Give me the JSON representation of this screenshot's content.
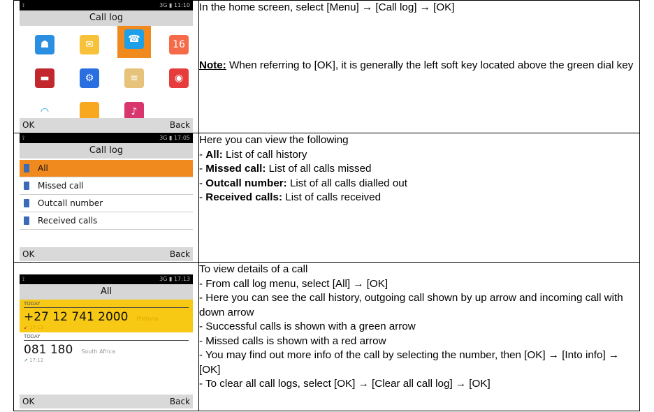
{
  "rows": [
    {
      "screen": {
        "status_time": "11:10",
        "status_net": "3G",
        "title": "Call log",
        "apps": [
          {
            "icon": "contacts-icon",
            "color": "#2a8fe0",
            "glyph": "☗"
          },
          {
            "icon": "message-icon",
            "color": "#f7c23a",
            "glyph": "✉"
          },
          {
            "icon": "call-log-icon",
            "color": "#1ea0e8",
            "glyph": "☎"
          },
          {
            "icon": "calendar-icon",
            "color": "#f56b4a",
            "glyph": "16"
          },
          {
            "icon": "toolbox-icon",
            "color": "#c1272d",
            "glyph": "▬"
          },
          {
            "icon": "settings-icon",
            "color": "#2a6fe0",
            "glyph": "⚙"
          },
          {
            "icon": "folder-icon",
            "color": "#e7c27a",
            "glyph": "≡"
          },
          {
            "icon": "browser-icon",
            "color": "#e63c3c",
            "glyph": "◉"
          },
          {
            "icon": "wifi-icon",
            "color": "#ffffff",
            "glyph": "◠"
          },
          {
            "icon": "notes-icon",
            "color": "#f7a81e",
            "glyph": ""
          },
          {
            "icon": "music-icon",
            "color": "#d9366e",
            "glyph": "♪"
          }
        ],
        "ok": "OK",
        "back": "Back"
      },
      "text": {
        "line1": "In the home screen, select [Menu] → [Call log] → [OK]",
        "note_label": "Note:",
        "note_body": " When referring to [OK], it is generally the left soft key located above the green dial key"
      }
    },
    {
      "screen": {
        "status_time": "17:05",
        "status_net": "3G",
        "title": "Call log",
        "items": [
          "All",
          "Missed call",
          "Outcall number",
          "Received calls"
        ],
        "ok": "OK",
        "back": "Back"
      },
      "text": {
        "intro": "Here you can view the following",
        "items": [
          {
            "label": "All:",
            "desc": " List of call history"
          },
          {
            "label": "Missed call:",
            "desc": " List of all calls missed"
          },
          {
            "label": "Outcall number:",
            "desc": " List of all calls dialled out"
          },
          {
            "label": "Received calls:",
            "desc": " List of calls received"
          }
        ]
      }
    },
    {
      "screen": {
        "status_time": "17:13",
        "status_net": "3G",
        "title": "All",
        "entries": [
          {
            "day": "TODAY",
            "number": "+27 12 741 2000",
            "place": "Pretoria",
            "time": "17:13",
            "arrow": "↙",
            "arrow_color": "#d92020",
            "place_color": "#e0a900"
          },
          {
            "day": "TODAY",
            "number": "081 180",
            "place": "South Africa",
            "time": "17:12",
            "arrow": "↗",
            "arrow_color": "#30a030",
            "place_color": "#999999"
          }
        ],
        "ok": "OK",
        "back": "Back"
      },
      "text": {
        "lines": [
          "To view details of a call",
          "- From call log menu, select [All] → [OK]",
          "- Here you can see the call history, outgoing call shown by up arrow and incoming call with down arrow",
          "- Successful calls is shown with a green arrow",
          "- Missed calls is shown with a red arrow",
          "- You may find out more info of the call by selecting the number, then [OK] → [Into info] → [OK]",
          "- To clear all call logs, select [OK] → [Clear all call log] → [OK]"
        ]
      }
    }
  ]
}
